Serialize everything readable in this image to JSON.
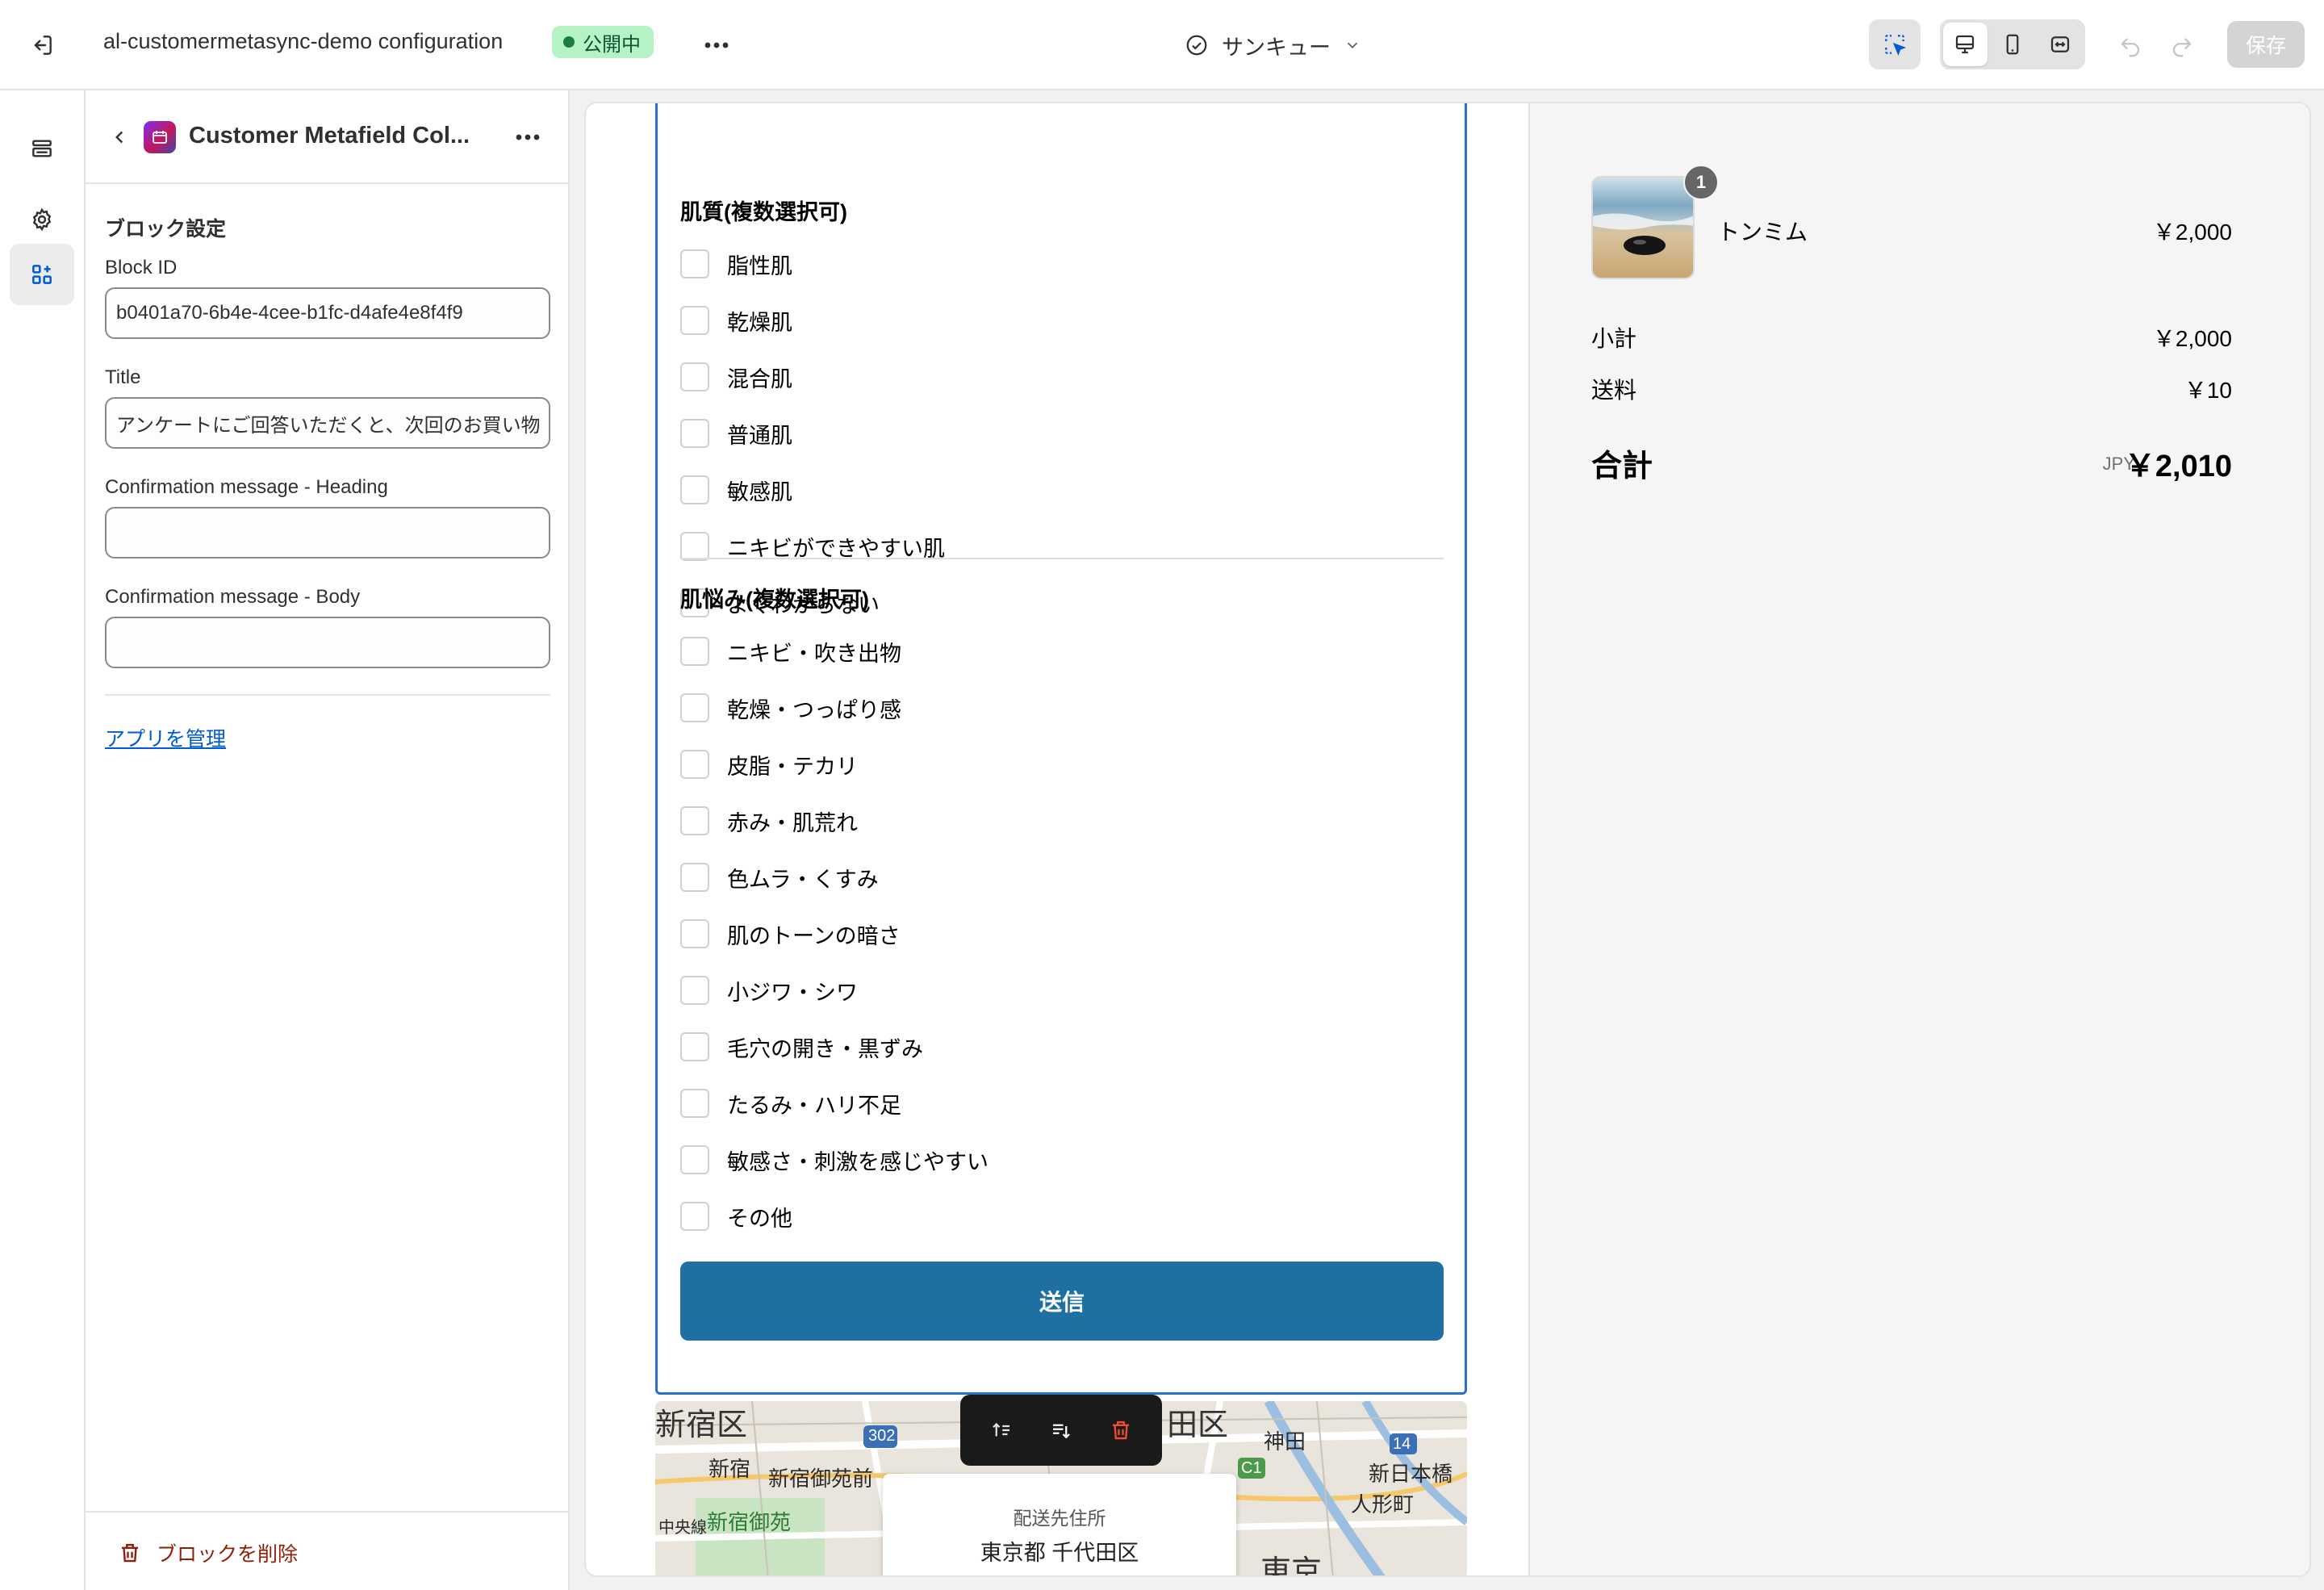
{
  "topbar": {
    "app_title": "al-customermetasync-demo configuration",
    "status": "公開中",
    "page_select": "サンキュー",
    "save_label": "保存"
  },
  "panel": {
    "title": "Customer Metafield Col...",
    "section_title": "ブロック設定",
    "fields": {
      "block_id_label": "Block ID",
      "block_id_value": "b0401a70-6b4e-4cee-b1fc-d4afe4e8f4f9",
      "title_label": "Title",
      "title_value": "アンケートにご回答いただくと、次回のお買い物",
      "heading_label": "Confirmation message - Heading",
      "heading_value": "",
      "body_label": "Confirmation message - Body",
      "body_value": ""
    },
    "manage_link": "アプリを管理",
    "delete_label": "ブロックを削除"
  },
  "form": {
    "group1_title": "肌質(複数選択可)",
    "group1_options": [
      "脂性肌",
      "乾燥肌",
      "混合肌",
      "普通肌",
      "敏感肌",
      "ニキビができやすい肌",
      "よくわからない"
    ],
    "group2_title": "肌悩み(複数選択可)",
    "group2_options": [
      "ニキビ・吹き出物",
      "乾燥・つっぱり感",
      "皮脂・テカリ",
      "赤み・肌荒れ",
      "色ムラ・くすみ",
      "肌のトーンの暗さ",
      "小ジワ・シワ",
      "毛穴の開き・黒ずみ",
      "たるみ・ハリ不足",
      "敏感さ・刺激を感じやすい",
      "その他"
    ],
    "submit_label": "送信"
  },
  "map": {
    "labels": [
      "新宿区",
      "田区",
      "302",
      "新宿",
      "新宿御苑前",
      "神田",
      "14",
      "C1",
      "新日本橋",
      "新宿御苑",
      "人形町",
      "中央線",
      "東京"
    ],
    "address_label": "配送先住所",
    "address_value": "東京都 千代田区"
  },
  "summary": {
    "item_qty": "1",
    "item_name": "トンミム",
    "item_price": "￥2,000",
    "subtotal_label": "小計",
    "subtotal_value": "￥2,000",
    "shipping_label": "送料",
    "shipping_value": "￥10",
    "total_label": "合計",
    "total_currency": "JPY",
    "total_value": "￥2,010"
  },
  "colors": {
    "accent_blue": "#2c6ecb",
    "submit_blue": "#1f6fa3",
    "status_green_bg": "#b5f3c6",
    "danger_red": "#8e1f0b"
  }
}
